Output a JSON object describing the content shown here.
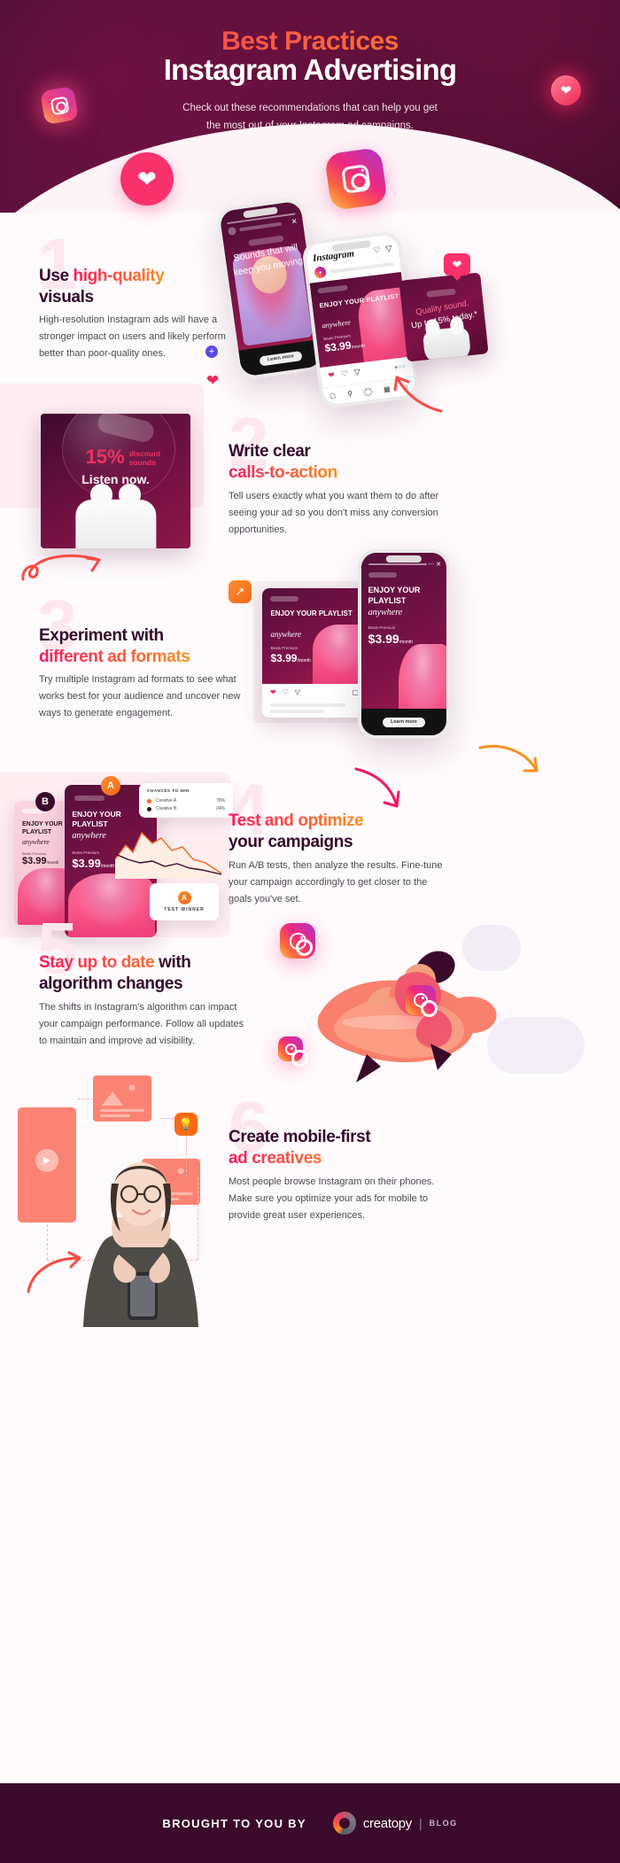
{
  "header": {
    "title_top": "Best Practices",
    "title_main": "Instagram Advertising",
    "subtitle_line1": "Check out these recommendations that can help you get",
    "subtitle_line2": "the most out of your Instagram ad campaigns."
  },
  "sections": [
    {
      "number": "1",
      "head_dark": "Use ",
      "head_grad": "high-quality",
      "head_line2": "visuals",
      "body": "High-resolution Instagram ads will have a stronger impact on users and likely perform better than poor-quality ones."
    },
    {
      "number": "2",
      "head_dark": "Write clear",
      "head_grad": "calls-to-action",
      "body": "Tell users exactly what you want them to do after seeing your ad so you don't miss any conversion opportunities."
    },
    {
      "number": "3",
      "head_dark": "Experiment with",
      "head_grad": "different ad formats",
      "body": "Try multiple Instagram ad formats to see what works best for your audience and uncover new ways to generate engagement."
    },
    {
      "number": "4",
      "head_grad": "Test and optimize",
      "head_dark": "your campaigns",
      "body": "Run A/B tests, then analyze the results. Fine-tune your campaign accordingly to get closer to the goals you've set."
    },
    {
      "number": "5",
      "head_grad": "Stay up to date",
      "head_dark": "with",
      "head_line2": "algorithm changes",
      "body": "The shifts in Instagram's algorithm can impact your campaign performance. Follow all updates to maintain and improve ad visibility."
    },
    {
      "number": "6",
      "head_dark": "Create mobile-first",
      "head_grad": "ad creatives",
      "body": "Most people browse Instagram on their phones. Make sure you optimize your ads for mobile to provide great user experiences."
    }
  ],
  "mockups": {
    "story_phone": {
      "story_text": "Sounds that will keep you moving",
      "cta": "Learn more"
    },
    "feed_phone": {
      "logo": "Instagram",
      "post_title": "ENJOY YOUR PLAYLIST",
      "post_script": "anywhere",
      "post_label": "Beats Premium",
      "post_price": "$3.99",
      "post_period": "/month"
    },
    "square_card": {
      "line1": "Quality sound.",
      "line2": "Up to 15% today.*"
    },
    "airpods_card": {
      "percent": "15%",
      "discount_line1": "discount",
      "discount_line2": "sounds",
      "cta": "Listen now."
    },
    "formats_card": {
      "title": "ENJOY YOUR PLAYLIST",
      "script": "anywhere",
      "label": "Beats Premium",
      "price": "$3.99",
      "period": "/month",
      "cta": "Learn more"
    },
    "ab_test": {
      "variant_a": "A",
      "variant_b": "B",
      "legend_title": "CHANCES TO WIN",
      "rows": [
        {
          "name": "Creative A",
          "value": "76%",
          "color": "#f4661d"
        },
        {
          "name": "Creative B",
          "value": "24%",
          "color": "#3b0a2b"
        }
      ],
      "winner_badge": "A",
      "winner_label": "TEST WINNER"
    }
  },
  "footer": {
    "brought_by": "BROUGHT TO YOU BY",
    "brand": "creatopy",
    "separator": "|",
    "blog": "BLOG"
  },
  "colors": {
    "pink": "#f6185f",
    "orange": "#fb8f1d",
    "dark_plum": "#340a2b",
    "footer_bg": "#3b0a2b",
    "pale_pink": "#fde7ee"
  }
}
